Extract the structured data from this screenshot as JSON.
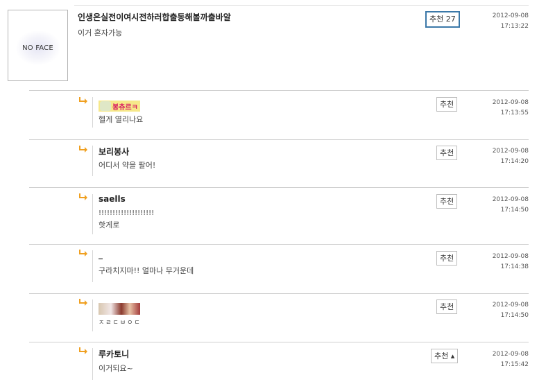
{
  "main_comment": {
    "avatar_text": "NO FACE",
    "author": "인생은실전이여시전하러합출동해볼까출바알",
    "text": "이거 혼자가능",
    "recommend_label": "추천 27",
    "date": "2012-09-08",
    "time": "17:13:22"
  },
  "replies": [
    {
      "author_image_text": "봉츄르ㅋ",
      "text": "헬게 열리나요",
      "recommend_label": "추천",
      "date": "2012-09-08",
      "time": "17:13:55"
    },
    {
      "author": "보리봉사",
      "text": "어디서 약을 팔어!",
      "recommend_label": "추천",
      "date": "2012-09-08",
      "time": "17:14:20"
    },
    {
      "author": "saells",
      "text_line1": "!!!!!!!!!!!!!!!!!!!!",
      "text_line2": "핫게로",
      "recommend_label": "추천",
      "date": "2012-09-08",
      "time": "17:14:50"
    },
    {
      "author": "_",
      "text": "구라치지마!! 얼마나 무거운데",
      "recommend_label": "추천",
      "date": "2012-09-08",
      "time": "17:14:38"
    },
    {
      "text": "ㅈㄹㄷㅂㅇㄷ",
      "recommend_label": "추천",
      "date": "2012-09-08",
      "time": "17:14:50"
    },
    {
      "author": "루카토니",
      "text": "이거되요~",
      "recommend_label": "추천 ▴",
      "date": "2012-09-08",
      "time": "17:15:42"
    }
  ],
  "icons": {
    "reply_arrow": "reply-arrow-icon"
  },
  "colors": {
    "recommend_active_border": "#3b78a8",
    "reply_arrow": "#f0a020"
  }
}
